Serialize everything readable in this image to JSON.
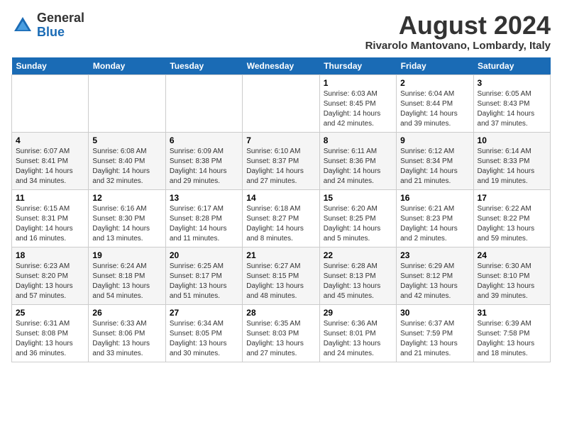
{
  "header": {
    "logo_general": "General",
    "logo_blue": "Blue",
    "title": "August 2024",
    "subtitle": "Rivarolo Mantovano, Lombardy, Italy"
  },
  "calendar": {
    "days_of_week": [
      "Sunday",
      "Monday",
      "Tuesday",
      "Wednesday",
      "Thursday",
      "Friday",
      "Saturday"
    ],
    "weeks": [
      [
        {
          "day": "",
          "info": ""
        },
        {
          "day": "",
          "info": ""
        },
        {
          "day": "",
          "info": ""
        },
        {
          "day": "",
          "info": ""
        },
        {
          "day": "1",
          "info": "Sunrise: 6:03 AM\nSunset: 8:45 PM\nDaylight: 14 hours and 42 minutes."
        },
        {
          "day": "2",
          "info": "Sunrise: 6:04 AM\nSunset: 8:44 PM\nDaylight: 14 hours and 39 minutes."
        },
        {
          "day": "3",
          "info": "Sunrise: 6:05 AM\nSunset: 8:43 PM\nDaylight: 14 hours and 37 minutes."
        }
      ],
      [
        {
          "day": "4",
          "info": "Sunrise: 6:07 AM\nSunset: 8:41 PM\nDaylight: 14 hours and 34 minutes."
        },
        {
          "day": "5",
          "info": "Sunrise: 6:08 AM\nSunset: 8:40 PM\nDaylight: 14 hours and 32 minutes."
        },
        {
          "day": "6",
          "info": "Sunrise: 6:09 AM\nSunset: 8:38 PM\nDaylight: 14 hours and 29 minutes."
        },
        {
          "day": "7",
          "info": "Sunrise: 6:10 AM\nSunset: 8:37 PM\nDaylight: 14 hours and 27 minutes."
        },
        {
          "day": "8",
          "info": "Sunrise: 6:11 AM\nSunset: 8:36 PM\nDaylight: 14 hours and 24 minutes."
        },
        {
          "day": "9",
          "info": "Sunrise: 6:12 AM\nSunset: 8:34 PM\nDaylight: 14 hours and 21 minutes."
        },
        {
          "day": "10",
          "info": "Sunrise: 6:14 AM\nSunset: 8:33 PM\nDaylight: 14 hours and 19 minutes."
        }
      ],
      [
        {
          "day": "11",
          "info": "Sunrise: 6:15 AM\nSunset: 8:31 PM\nDaylight: 14 hours and 16 minutes."
        },
        {
          "day": "12",
          "info": "Sunrise: 6:16 AM\nSunset: 8:30 PM\nDaylight: 14 hours and 13 minutes."
        },
        {
          "day": "13",
          "info": "Sunrise: 6:17 AM\nSunset: 8:28 PM\nDaylight: 14 hours and 11 minutes."
        },
        {
          "day": "14",
          "info": "Sunrise: 6:18 AM\nSunset: 8:27 PM\nDaylight: 14 hours and 8 minutes."
        },
        {
          "day": "15",
          "info": "Sunrise: 6:20 AM\nSunset: 8:25 PM\nDaylight: 14 hours and 5 minutes."
        },
        {
          "day": "16",
          "info": "Sunrise: 6:21 AM\nSunset: 8:23 PM\nDaylight: 14 hours and 2 minutes."
        },
        {
          "day": "17",
          "info": "Sunrise: 6:22 AM\nSunset: 8:22 PM\nDaylight: 13 hours and 59 minutes."
        }
      ],
      [
        {
          "day": "18",
          "info": "Sunrise: 6:23 AM\nSunset: 8:20 PM\nDaylight: 13 hours and 57 minutes."
        },
        {
          "day": "19",
          "info": "Sunrise: 6:24 AM\nSunset: 8:18 PM\nDaylight: 13 hours and 54 minutes."
        },
        {
          "day": "20",
          "info": "Sunrise: 6:25 AM\nSunset: 8:17 PM\nDaylight: 13 hours and 51 minutes."
        },
        {
          "day": "21",
          "info": "Sunrise: 6:27 AM\nSunset: 8:15 PM\nDaylight: 13 hours and 48 minutes."
        },
        {
          "day": "22",
          "info": "Sunrise: 6:28 AM\nSunset: 8:13 PM\nDaylight: 13 hours and 45 minutes."
        },
        {
          "day": "23",
          "info": "Sunrise: 6:29 AM\nSunset: 8:12 PM\nDaylight: 13 hours and 42 minutes."
        },
        {
          "day": "24",
          "info": "Sunrise: 6:30 AM\nSunset: 8:10 PM\nDaylight: 13 hours and 39 minutes."
        }
      ],
      [
        {
          "day": "25",
          "info": "Sunrise: 6:31 AM\nSunset: 8:08 PM\nDaylight: 13 hours and 36 minutes."
        },
        {
          "day": "26",
          "info": "Sunrise: 6:33 AM\nSunset: 8:06 PM\nDaylight: 13 hours and 33 minutes."
        },
        {
          "day": "27",
          "info": "Sunrise: 6:34 AM\nSunset: 8:05 PM\nDaylight: 13 hours and 30 minutes."
        },
        {
          "day": "28",
          "info": "Sunrise: 6:35 AM\nSunset: 8:03 PM\nDaylight: 13 hours and 27 minutes."
        },
        {
          "day": "29",
          "info": "Sunrise: 6:36 AM\nSunset: 8:01 PM\nDaylight: 13 hours and 24 minutes."
        },
        {
          "day": "30",
          "info": "Sunrise: 6:37 AM\nSunset: 7:59 PM\nDaylight: 13 hours and 21 minutes."
        },
        {
          "day": "31",
          "info": "Sunrise: 6:39 AM\nSunset: 7:58 PM\nDaylight: 13 hours and 18 minutes."
        }
      ]
    ]
  }
}
